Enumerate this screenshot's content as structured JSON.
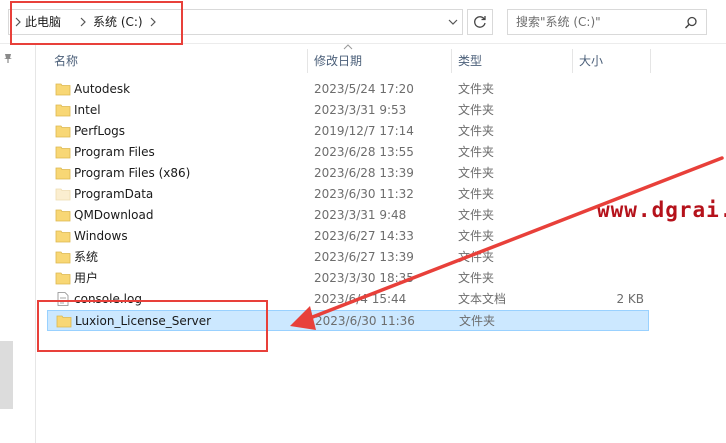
{
  "address": {
    "crumbs": [
      "此电脑",
      "系统 (C:)"
    ]
  },
  "search": {
    "placeholder": "搜索\"系统 (C:)\""
  },
  "columns": {
    "name": "名称",
    "date": "修改日期",
    "type": "类型",
    "size": "大小"
  },
  "files": [
    {
      "name": "Autodesk",
      "date": "2023/5/24 17:20",
      "type": "文件夹",
      "size": "",
      "icon": "folder-icon"
    },
    {
      "name": "Intel",
      "date": "2023/3/31 9:53",
      "type": "文件夹",
      "size": "",
      "icon": "folder-icon"
    },
    {
      "name": "PerfLogs",
      "date": "2019/12/7 17:14",
      "type": "文件夹",
      "size": "",
      "icon": "folder-icon"
    },
    {
      "name": "Program Files",
      "date": "2023/6/28 13:55",
      "type": "文件夹",
      "size": "",
      "icon": "folder-icon"
    },
    {
      "name": "Program Files (x86)",
      "date": "2023/6/28 13:39",
      "type": "文件夹",
      "size": "",
      "icon": "folder-icon"
    },
    {
      "name": "ProgramData",
      "date": "2023/6/30 11:32",
      "type": "文件夹",
      "size": "",
      "icon": "hidden-folder-icon"
    },
    {
      "name": "QMDownload",
      "date": "2023/3/31 9:48",
      "type": "文件夹",
      "size": "",
      "icon": "folder-icon"
    },
    {
      "name": "Windows",
      "date": "2023/6/27 14:33",
      "type": "文件夹",
      "size": "",
      "icon": "folder-icon"
    },
    {
      "name": "系统",
      "date": "2023/6/27 13:39",
      "type": "文件夹",
      "size": "",
      "icon": "folder-icon"
    },
    {
      "name": "用户",
      "date": "2023/3/30 18:35",
      "type": "文件夹",
      "size": "",
      "icon": "folder-icon"
    },
    {
      "name": "console.log",
      "date": "2023/6/4 15:44",
      "type": "文本文档",
      "size": "2 KB",
      "icon": "text-file-icon"
    },
    {
      "name": "Luxion_License_Server",
      "date": "2023/6/30 11:36",
      "type": "文件夹",
      "size": "",
      "icon": "folder-icon",
      "selected": true
    }
  ],
  "watermark": "www.dgrai.",
  "colors": {
    "accent_red": "#e8403a",
    "selection": "#cce8ff",
    "folder": "#f8d775",
    "watermark": "#b5121b"
  }
}
